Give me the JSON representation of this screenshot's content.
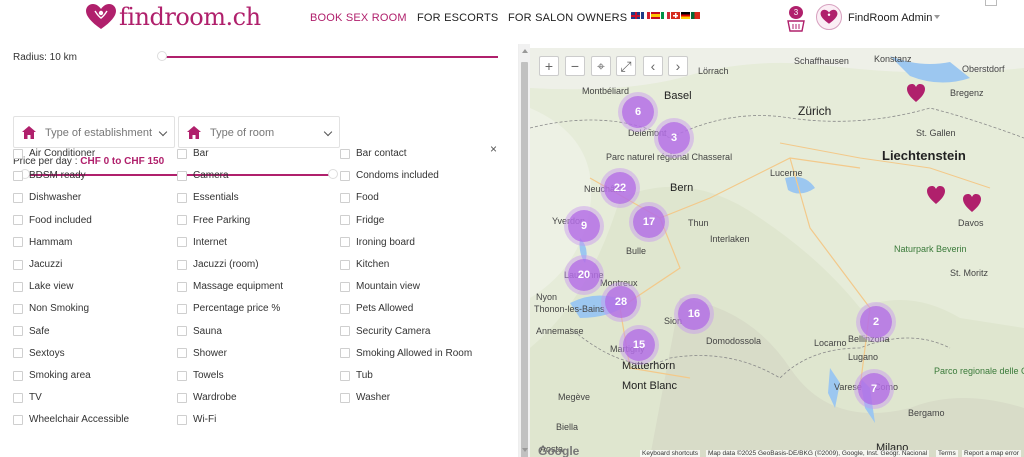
{
  "header": {
    "brand": "findroom.ch",
    "nav": [
      {
        "label": "BOOK SEX ROOM",
        "active": true
      },
      {
        "label": "FOR ESCORTS",
        "active": false
      },
      {
        "label": "FOR SALON OWNERS",
        "active": false
      }
    ],
    "cart_count": "3",
    "user_name": "FindRoom Admin"
  },
  "filters": {
    "radius_label": "Radius: 10 km",
    "radius_fraction": 0.98,
    "establishment_placeholder": "Type of establishment",
    "room_placeholder": "Type of room",
    "price_label": "Price per day :",
    "price_value": "CHF 0 to CHF 150",
    "price_fraction": 0.95,
    "close_symbol": "×",
    "amenities": [
      "Air Conditioner",
      "Bar",
      "Bar contact",
      "BDSM ready",
      "Camera",
      "Condoms included",
      "Dishwasher",
      "Essentials",
      "Food",
      "Food included",
      "Free Parking",
      "Fridge",
      "Hammam",
      "Internet",
      "Ironing board",
      "Jacuzzi",
      "Jacuzzi (room)",
      "Kitchen",
      "Lake view",
      "Massage equipment",
      "Mountain view",
      "Non Smoking",
      "Percentage price %",
      "Pets Allowed",
      "Safe",
      "Sauna",
      "Security Camera",
      "Sextoys",
      "Shower",
      "Smoking Allowed in Room",
      "Smoking area",
      "Towels",
      "Tub",
      "TV",
      "Wardrobe",
      "Washer",
      "Wheelchair Accessible",
      "Wi-Fi"
    ]
  },
  "map": {
    "controls": [
      "+",
      "−",
      "⌖",
      "⤢",
      "‹",
      "›"
    ],
    "clusters": [
      {
        "count": "6"
      },
      {
        "count": "3"
      },
      {
        "count": "22"
      },
      {
        "count": "9"
      },
      {
        "count": "17"
      },
      {
        "count": "20"
      },
      {
        "count": "28"
      },
      {
        "count": "16"
      },
      {
        "count": "15"
      },
      {
        "count": "2"
      },
      {
        "count": "7"
      }
    ],
    "labels": [
      "Konstanz",
      "Schaffhausen",
      "Lörrach",
      "Basel",
      "Montbéliard",
      "Zürich",
      "Delémont",
      "Parc naturel régional Chasseral",
      "Neuchâtel",
      "Bern",
      "Thun",
      "Lucerne",
      "Yverdon",
      "Interlaken",
      "Bulle",
      "Lausanne",
      "Montreux",
      "Nyon",
      "Thonon-les-Bains",
      "Annemasse",
      "Sion",
      "Martigny",
      "Matterhorn",
      "Mont Blanc",
      "Domodossola",
      "Bellinzona",
      "Lugano",
      "Locarno",
      "Varese",
      "Como",
      "Bergamo",
      "Milano",
      "Megève",
      "St. Gallen",
      "Liechtenstein",
      "Davos",
      "Naturpark Beverin",
      "St. Moritz",
      "Parco regionale delle Orobie Bergamasche",
      "Aosta",
      "Biella",
      "Oberstdorf",
      "Bregenz"
    ],
    "google": "Google",
    "attribution": [
      "Keyboard shortcuts",
      "Map data ©2025 GeoBasis-DE/BKG (©2009), Google, Inst. Geogr. Nacional",
      "Terms",
      "Report a map error"
    ]
  },
  "colors": {
    "brand": "#b0206c",
    "cluster": "#b46ee6"
  }
}
